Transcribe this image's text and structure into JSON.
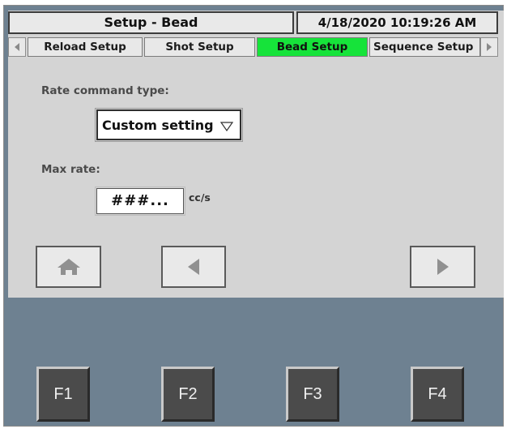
{
  "header": {
    "title": "Setup - Bead",
    "datetime": "4/18/2020 10:19:26 AM"
  },
  "tabs": [
    {
      "label": "Reload Setup",
      "active": false
    },
    {
      "label": "Shot Setup",
      "active": false
    },
    {
      "label": "Bead Setup",
      "active": true
    },
    {
      "label": "Sequence Setup",
      "active": false
    }
  ],
  "active_tab_color": "#16e33a",
  "form": {
    "rate_command_label": "Rate command type:",
    "rate_command_value": "Custom setting",
    "max_rate_label": "Max rate:",
    "max_rate_value": "###...",
    "max_rate_unit": "cc/s"
  },
  "nav": {
    "home_icon": "home-icon",
    "back_icon": "triangle-left-icon",
    "forward_icon": "triangle-right-icon"
  },
  "function_keys": [
    "F1",
    "F2",
    "F3",
    "F4"
  ],
  "colors": {
    "screen_bg": "#d4d4d4",
    "panel_bg": "#6e8191",
    "fkey_bg": "#4b4b4b"
  }
}
